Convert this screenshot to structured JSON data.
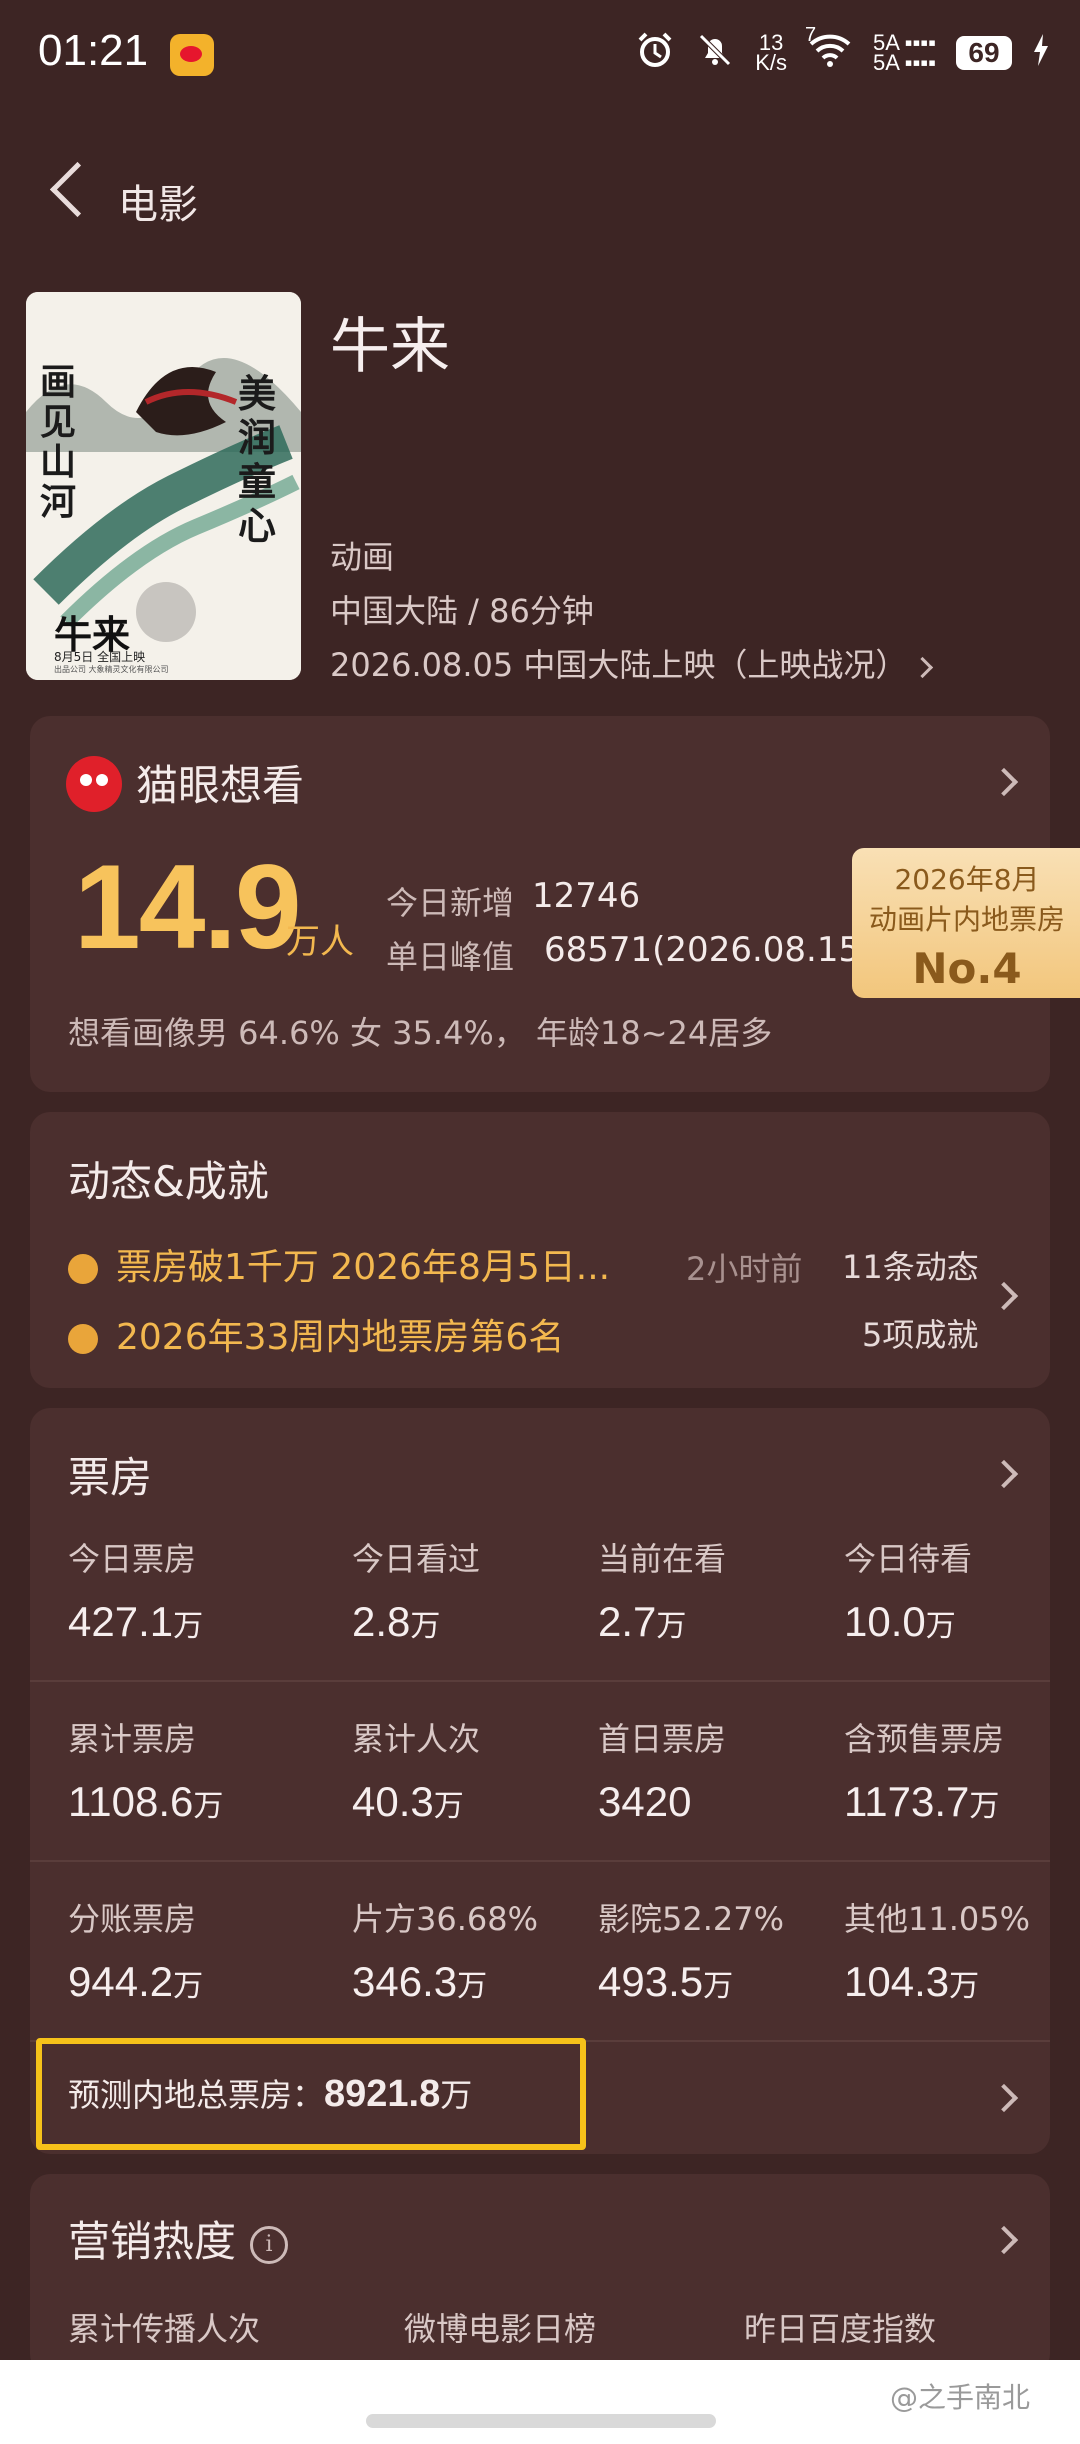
{
  "status_bar": {
    "time": "01:21",
    "net_speed_top": "13",
    "net_speed_bottom": "K/s",
    "wifi_num": "7",
    "sim1": "5A",
    "sim2": "5A",
    "battery": "69"
  },
  "header": {
    "back_label": "电影"
  },
  "movie": {
    "title": "牛来",
    "genre": "动画",
    "region_duration": "中国大陆 / 86分钟",
    "release": "2026.08.05 中国大陆上映（上映战况）",
    "poster": {
      "text_left": "画见山河",
      "text_right": "美润童心",
      "name": "牛来",
      "date_line": "8月5日 全国上映",
      "fine_print": "出品公司 大象精灵文化有限公司"
    }
  },
  "maoyan": {
    "title": "猫眼想看",
    "count": "14.9",
    "unit": "万人",
    "today_label": "今日新增",
    "today_value": "12746",
    "peak_label": "单日峰值",
    "peak_value": "68571(2026.08.15)",
    "rank_line1": "2026年8月",
    "rank_line2": "动画片内地票房",
    "rank_no": "No.4",
    "portrait": "想看画像男 64.6%  女 35.4%，  年龄18~24居多"
  },
  "dynamics": {
    "title": "动态&成就",
    "line1": "票房破1千万 2026年8月5日...",
    "line1_time": "2小时前",
    "line2": "2026年33周内地票房第6名",
    "count1": "11条动态",
    "count2": "5项成就"
  },
  "boxoffice": {
    "title": "票房",
    "rows": [
      [
        {
          "label": "今日票房",
          "value": "427.1",
          "unit": "万"
        },
        {
          "label": "今日看过",
          "value": "2.8",
          "unit": "万"
        },
        {
          "label": "当前在看",
          "value": "2.7",
          "unit": "万"
        },
        {
          "label": "今日待看",
          "value": "10.0",
          "unit": "万"
        }
      ],
      [
        {
          "label": "累计票房",
          "value": "1108.6",
          "unit": "万"
        },
        {
          "label": "累计人次",
          "value": "40.3",
          "unit": "万"
        },
        {
          "label": "首日票房",
          "value": "3420",
          "unit": ""
        },
        {
          "label": "含预售票房",
          "value": "1173.7",
          "unit": "万"
        }
      ],
      [
        {
          "label": "分账票房",
          "value": "944.2",
          "unit": "万"
        },
        {
          "label": "片方36.68%",
          "value": "346.3",
          "unit": "万"
        },
        {
          "label": "影院52.27%",
          "value": "493.5",
          "unit": "万"
        },
        {
          "label": "其他11.05%",
          "value": "104.3",
          "unit": "万"
        }
      ]
    ],
    "predict_label": "预测内地总票房：",
    "predict_value": "8921.8",
    "predict_unit": "万"
  },
  "marketing": {
    "title": "营销热度",
    "info_icon": "i",
    "cols": [
      "累计传播人次",
      "微博电影日榜",
      "昨日百度指数"
    ]
  },
  "watermark": "@之手南北",
  "colors": {
    "background": "#3d2524",
    "card": "#4b2f2e",
    "accent": "#f7c35c",
    "highlight_box": "#f6c21a"
  }
}
